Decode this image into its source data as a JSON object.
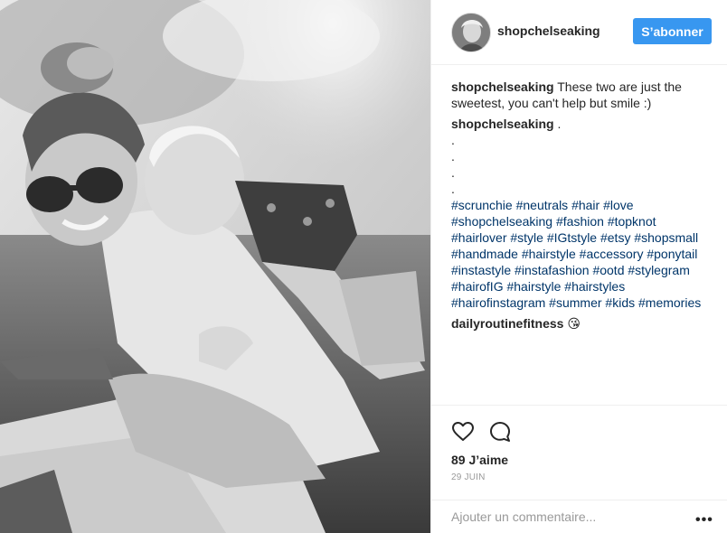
{
  "post": {
    "image_alt": "",
    "user": {
      "username": "shopchelseaking",
      "follow_label": "S’abonner"
    },
    "caption": {
      "author": "shopchelseaking",
      "text": "These two are just the sweetest, you can't help but smile :)"
    },
    "second_comment": {
      "author": "shopchelseaking",
      "text_start": ".",
      "dots": [
        ".",
        ".",
        ".",
        "."
      ],
      "hashtags": [
        "#scrunchie",
        "#neutrals",
        "#hair",
        "#love",
        "#shopchelseaking",
        "#fashion",
        "#topknot",
        "#hairlover",
        "#style",
        "#IGtstyle",
        "#etsy",
        "#shopsmall",
        "#handmade",
        "#hairstyle",
        "#accessory",
        "#ponytail",
        "#instastyle",
        "#instafashion",
        "#ootd",
        "#stylegram",
        "#hairofIG",
        "#hairstyle",
        "#hairstyles",
        "#hairofinstagram",
        "#summer",
        "#kids",
        "#memories"
      ]
    },
    "third_comment": {
      "author": "dailyroutinefitness",
      "emoji": "😘"
    },
    "likes": "89 J’aime",
    "date": "29 JUIN",
    "add_comment_placeholder": "Ajouter un commentaire...",
    "more_label": "•••",
    "icons": {
      "like": "heart-outline-icon",
      "comment": "speech-bubble-icon",
      "more": "ellipsis-icon"
    }
  }
}
